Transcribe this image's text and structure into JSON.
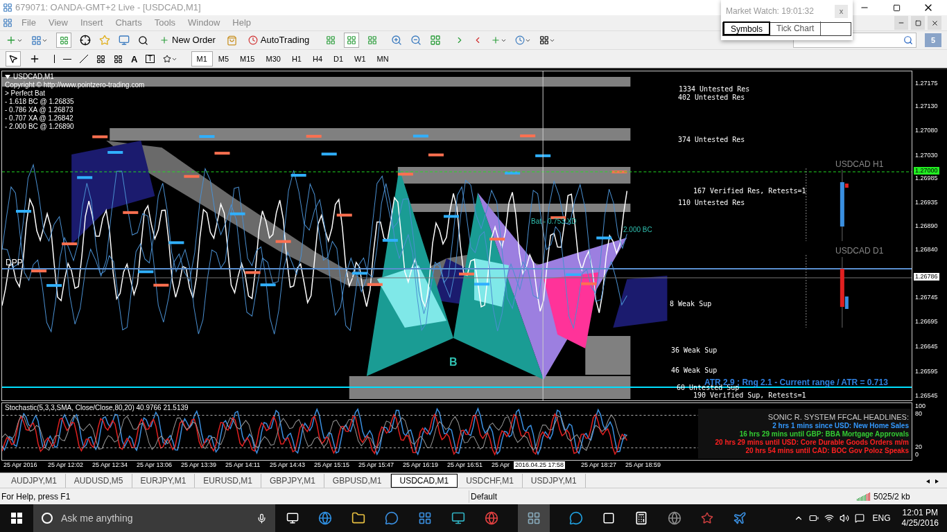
{
  "window": {
    "title": "679071: OANDA-GMT+2 Live - [USDCAD,M1]"
  },
  "menu": [
    "File",
    "View",
    "Insert",
    "Charts",
    "Tools",
    "Window",
    "Help"
  ],
  "toolbar": {
    "new_order": "New Order",
    "auto_trading": "AutoTrading",
    "text_tool": "A",
    "label_tool": "T"
  },
  "timeframes": [
    {
      "label": "M1",
      "selected": true
    },
    {
      "label": "M5",
      "selected": false
    },
    {
      "label": "M15",
      "selected": false
    },
    {
      "label": "M30",
      "selected": false
    },
    {
      "label": "H1",
      "selected": false
    },
    {
      "label": "H4",
      "selected": false
    },
    {
      "label": "D1",
      "selected": false
    },
    {
      "label": "W1",
      "selected": false
    },
    {
      "label": "MN",
      "selected": false
    }
  ],
  "market_watch": {
    "title": "Market Watch: 19:01:32",
    "close": "x",
    "tabs": [
      {
        "label": "Symbols",
        "selected": true
      },
      {
        "label": "Tick Chart",
        "selected": false
      }
    ]
  },
  "notification_count": "5",
  "chart": {
    "header": "USDCAD,M1",
    "info_lines": [
      "Copyright © http://www.pointzero-trading.com",
      "> Perfect Bat",
      "- 1.618 BC @ 1.26835",
      "- 0.786 XA @ 1.26873",
      "- 0.707 XA @ 1.26842",
      "- 2.000 BC @ 1.26890"
    ],
    "zone_labels": [
      "1334 Untested Res",
      "402 Untested Res",
      "374 Untested Res",
      "167 Verified Res, Retests=1",
      "110 Untested Res",
      "8 Weak Sup",
      "36 Weak Sup",
      "46 Weak Sup",
      "60 Untested Sup",
      "190 Verified Sup, Retests=1"
    ],
    "pattern_labels": [
      "DPP",
      "B",
      "Bat - 0.753 XD",
      "2.000 BC"
    ],
    "mini_charts": [
      "USDCAD H1",
      "USDCAD D1"
    ],
    "atr": "ATR 2.9 ; Rng 2.1 - Current range / ATR = 0.713",
    "price_ticks": [
      "1.27175",
      "1.27130",
      "1.27080",
      "1.27030",
      "1.26985",
      "1.26935",
      "1.26890",
      "1.26840",
      "1.26745",
      "1.26695",
      "1.26645",
      "1.26595",
      "1.26545"
    ],
    "current_price": "1.26786",
    "level_price": "1.27000"
  },
  "stochastic": {
    "label": "Stochastic(5,3,3,SMA, Close/Close,80,20) 40.9766 21.5139",
    "scale": [
      "100",
      "80",
      "20",
      "0"
    ],
    "headlines_title": "SONIC R. SYSTEM  FFCAL HEADLINES:",
    "headlines": [
      {
        "text": "2 hrs 1 mins since USD: New Home Sales",
        "color": "#3399ff"
      },
      {
        "text": "16 hrs 29 mins until GBP: BBA Mortgage Approvals",
        "color": "#33cc33"
      },
      {
        "text": "20 hrs 29 mins until USD: Core Durable Goods Orders m/m",
        "color": "#ff2020"
      },
      {
        "text": "20 hrs 54 mins until CAD: BOC Gov Poloz Speaks",
        "color": "#ff2020"
      }
    ]
  },
  "time_axis": [
    "25 Apr 2016",
    "25 Apr 12:02",
    "25 Apr 12:34",
    "25 Apr 13:06",
    "25 Apr 13:39",
    "25 Apr 14:11",
    "25 Apr 14:43",
    "25 Apr 15:15",
    "25 Apr 15:47",
    "25 Apr 16:19",
    "25 Apr 16:51",
    "25 Apr",
    "25 Apr 18:27",
    "25 Apr 18:59"
  ],
  "crosshair_time": "2016.04.25 17:58",
  "symbol_tabs": [
    {
      "label": "AUDJPY,M1",
      "selected": false
    },
    {
      "label": "AUDUSD,M5",
      "selected": false
    },
    {
      "label": "EURJPY,M1",
      "selected": false
    },
    {
      "label": "EURUSD,M1",
      "selected": false
    },
    {
      "label": "GBPJPY,M1",
      "selected": false
    },
    {
      "label": "GBPUSD,M1",
      "selected": false
    },
    {
      "label": "USDCAD,M1",
      "selected": true
    },
    {
      "label": "USDCHF,M1",
      "selected": false
    },
    {
      "label": "USDJPY,M1",
      "selected": false
    }
  ],
  "status_bar": {
    "help": "For Help, press F1",
    "profile": "Default",
    "traffic": "5025/2 kb"
  },
  "taskbar": {
    "search_placeholder": "Ask me anything",
    "language": "ENG",
    "time": "12:01 PM",
    "date": "4/25/2016"
  }
}
